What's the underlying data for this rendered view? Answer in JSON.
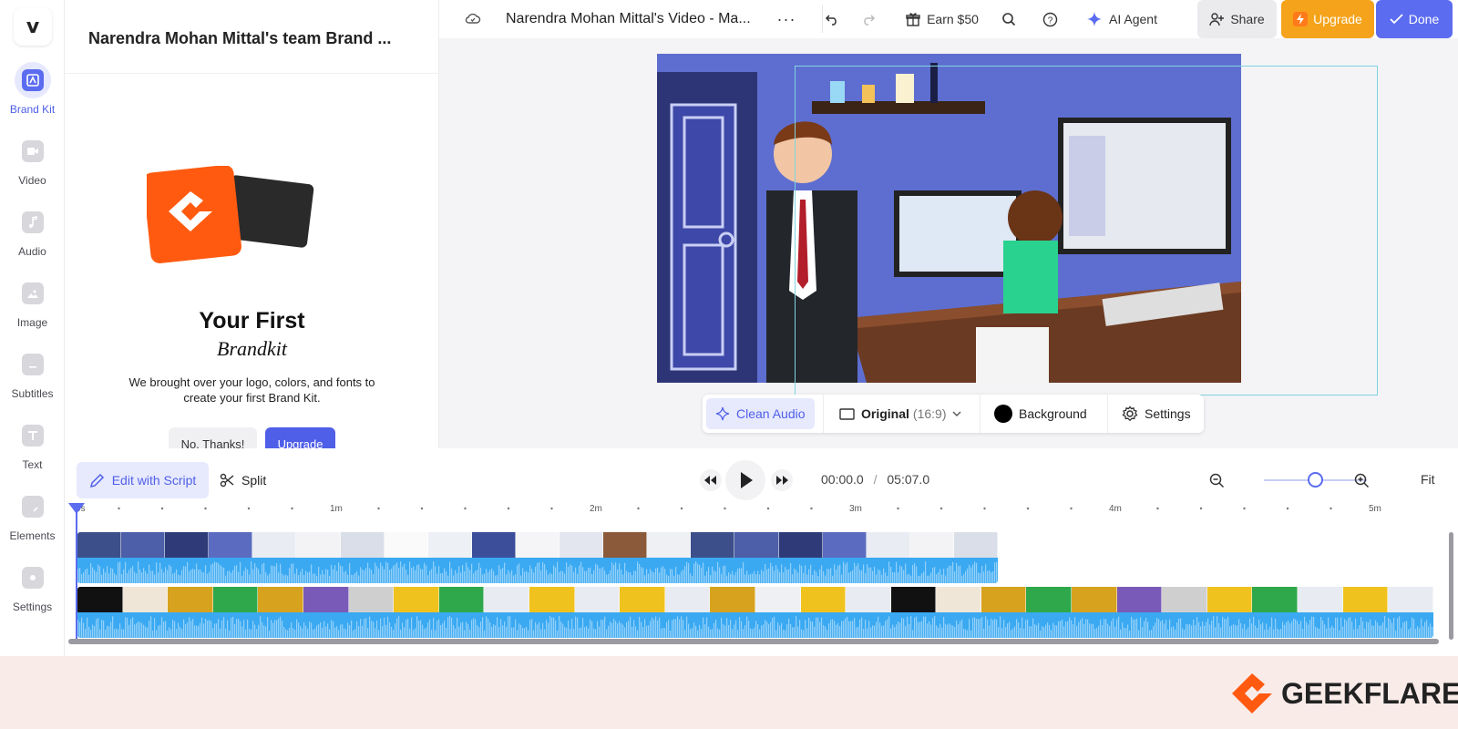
{
  "app": {
    "logo_letter": "v"
  },
  "rail": {
    "items": [
      {
        "label": "Brand Kit",
        "icon": "brand-kit-icon",
        "active": true
      },
      {
        "label": "Video",
        "icon": "video-icon"
      },
      {
        "label": "Audio",
        "icon": "music-note-icon"
      },
      {
        "label": "Image",
        "icon": "image-icon"
      },
      {
        "label": "Subtitles",
        "icon": "subtitles-icon"
      },
      {
        "label": "Text",
        "icon": "text-icon"
      },
      {
        "label": "Elements",
        "icon": "elements-icon"
      },
      {
        "label": "Settings",
        "icon": "settings-icon"
      }
    ]
  },
  "panel": {
    "title": "Narendra Mohan Mittal's team Brand ...",
    "heading": "Your First",
    "subheading": "Brandkit",
    "description": "We brought over your logo, colors, and fonts to create your first Brand Kit.",
    "no_thanks": "No, Thanks!",
    "upgrade": "Upgrade"
  },
  "topbar": {
    "doc_title": "Narendra Mohan Mittal's Video - Ma...",
    "earn": "Earn $50",
    "ai_agent": "AI Agent",
    "share": "Share",
    "upgrade": "Upgrade",
    "done": "Done"
  },
  "canvas_toolbar": {
    "clean_audio": "Clean Audio",
    "ratio": "Original",
    "ratio_detail": "(16:9)",
    "background": "Background",
    "settings": "Settings"
  },
  "timeline": {
    "edit_script": "Edit with Script",
    "split": "Split",
    "current_time": "00:00.0",
    "separator": "/",
    "total_time": "05:07.0",
    "fit": "Fit",
    "ruler_labels": [
      "0s",
      "1m",
      "2m",
      "3m",
      "4m",
      "5m"
    ],
    "zoom_level": 0.5
  },
  "watermark": {
    "text": "GEEKFLARE"
  },
  "colors": {
    "accent": "#5b6cf0",
    "upgrade": "#f5a31a",
    "waveform": "#3aa9f2",
    "brand_orange": "#ff5a10"
  }
}
